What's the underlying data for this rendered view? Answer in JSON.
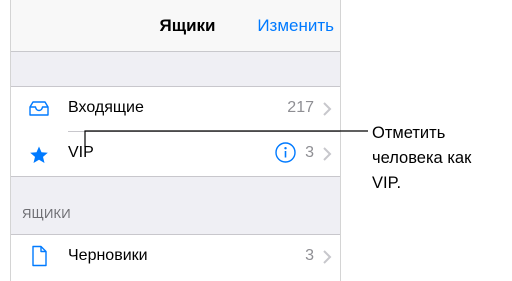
{
  "navbar": {
    "title": "Ящики",
    "edit_label": "Изменить"
  },
  "mailboxes": [
    {
      "label": "Входящие",
      "count": "217",
      "icon": "inbox-tray-icon"
    },
    {
      "label": "VIP",
      "count": "3",
      "icon": "star-icon"
    }
  ],
  "section": {
    "header": "ЯЩИКИ"
  },
  "accounts": [
    {
      "label": "Черновики",
      "count": "3",
      "icon": "document-icon"
    }
  ],
  "callout": {
    "text": "Отметить\nчеловека как\nVIP."
  },
  "colors": {
    "accent": "#007aff",
    "secondary_text": "#8e8e93",
    "group_background": "#efeff4",
    "separator": "#c8c7cc"
  }
}
